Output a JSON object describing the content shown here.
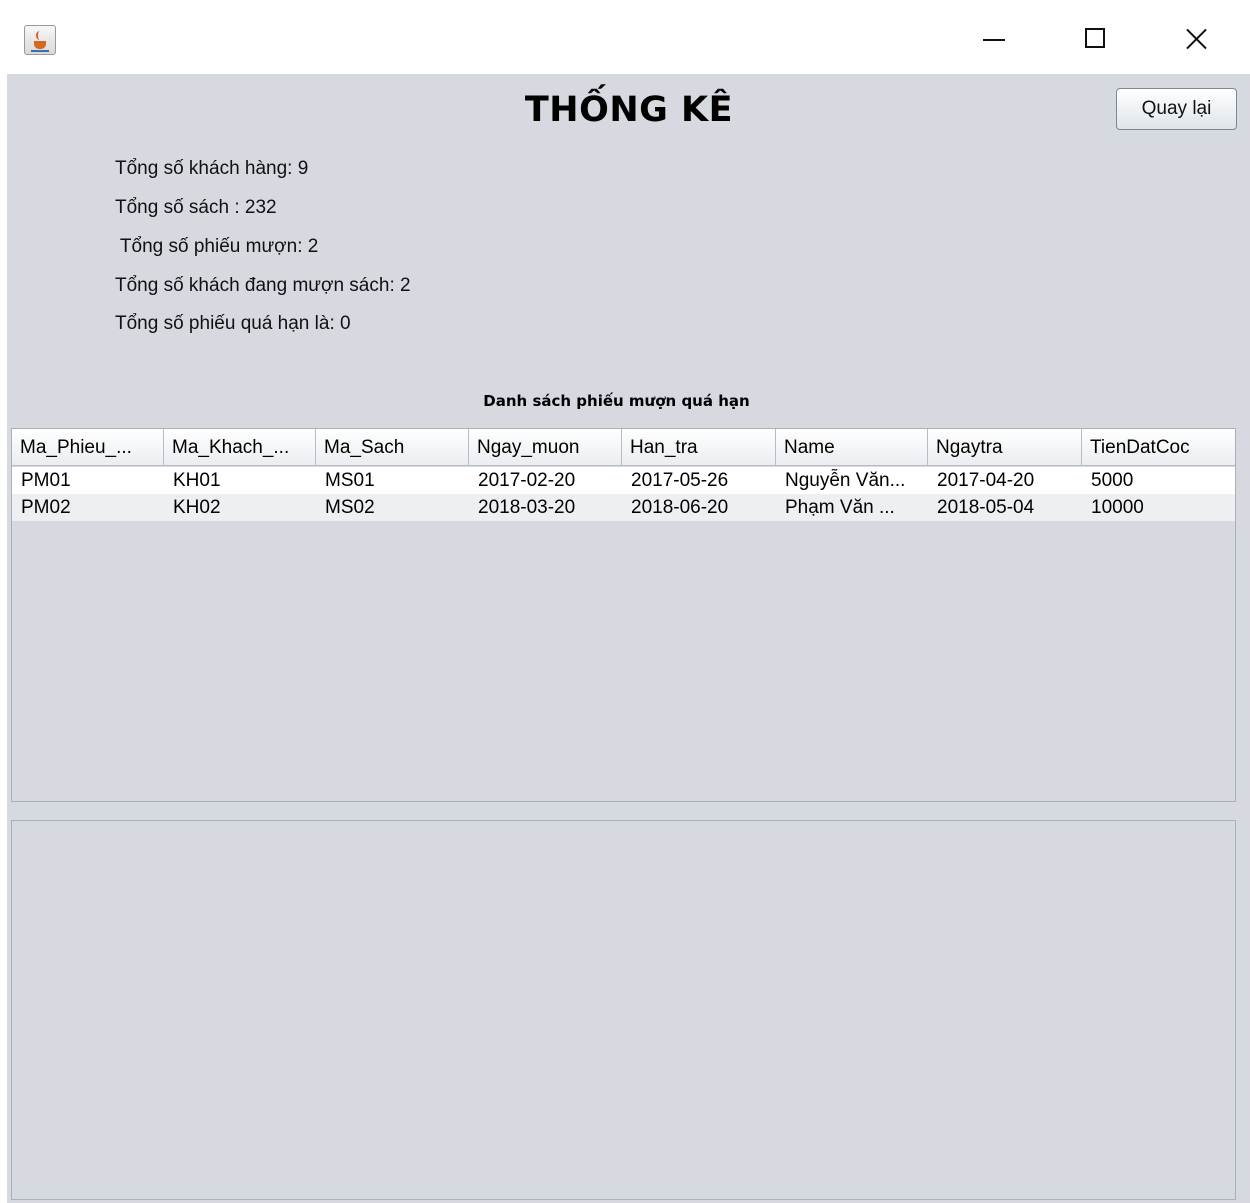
{
  "window": {
    "controls": {
      "minimize": "minimize-icon",
      "maximize": "maximize-icon",
      "close": "close-icon"
    },
    "app_icon": "java-cup-icon"
  },
  "header": {
    "title": "THỐNG KÊ",
    "back_label": "Quay lại"
  },
  "stats": [
    "Tổng số khách hàng: 9",
    "Tổng số sách : 232",
    " Tổng số phiếu mượn: 2",
    "Tổng số khách đang mượn sách: 2",
    "Tổng số phiếu quá hạn là: 0"
  ],
  "table": {
    "title": "Danh sách phiếu mượn quá hạn",
    "columns": [
      "Ma_Phieu_...",
      "Ma_Khach_...",
      "Ma_Sach",
      "Ngay_muon",
      "Han_tra",
      "Name",
      "Ngaytra",
      "TienDatCoc"
    ],
    "rows": [
      [
        "PM01",
        "KH01",
        "MS01",
        "2017-02-20",
        "2017-05-26",
        "Nguyễn Văn...",
        "2017-04-20",
        "5000"
      ],
      [
        "PM02",
        "KH02",
        "MS02",
        "2018-03-20",
        "2018-06-20",
        "Phạm Văn ...",
        "2018-05-04",
        "10000"
      ]
    ]
  },
  "colors": {
    "panel_bg": "#d6d9e0",
    "header_bg": "#ffffff",
    "row_alt": "#eeeff2"
  }
}
